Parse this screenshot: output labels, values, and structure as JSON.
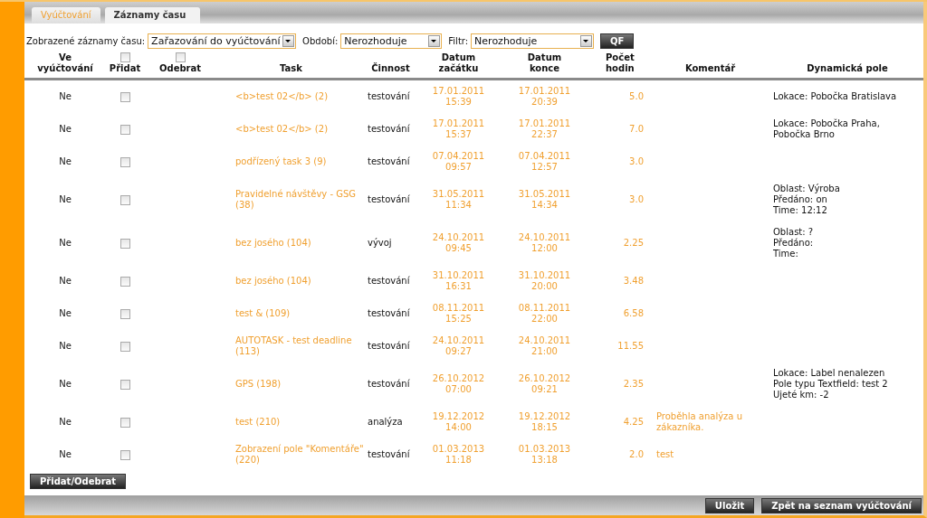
{
  "tabs": [
    {
      "label": "Vyúčtování",
      "selected": false
    },
    {
      "label": "Záznamy času",
      "selected": true
    }
  ],
  "filters": [
    {
      "label": "Zobrazené záznamy času:",
      "value": "Zařazování do vyúčtování"
    },
    {
      "label": "Období:",
      "value": "Nerozhoduje"
    },
    {
      "label": "Filtr:",
      "value": "Nerozhoduje"
    }
  ],
  "filter_button": "QF",
  "table": {
    "columns": [
      {
        "label": "Ve vyúčtování",
        "kind": "text"
      },
      {
        "label": "Přidat",
        "kind": "checkbox",
        "checked": false
      },
      {
        "label": "Odebrat",
        "kind": "checkbox",
        "checked": false
      },
      {
        "label": "Task",
        "kind": "text"
      },
      {
        "label": "Činnost",
        "kind": "text"
      },
      {
        "label": "Datum začátku",
        "kind": "text"
      },
      {
        "label": "Datum konce",
        "kind": "text"
      },
      {
        "label": "Počet hodin",
        "kind": "text"
      },
      {
        "label": "Komentář",
        "kind": "text"
      },
      {
        "label": "Dynamická pole",
        "kind": "text"
      }
    ],
    "rows": [
      {
        "in_billing": "Ne",
        "add_checked": false,
        "task": "<b>test 02</b> (2)",
        "activity": "testování",
        "start": [
          "17.01.2011",
          "15:39"
        ],
        "end": [
          "17.01.2011",
          "20:39"
        ],
        "hours": "5.0",
        "dynamic_fields": [
          "Lokace: Pobočka Bratislava"
        ]
      },
      {
        "in_billing": "Ne",
        "add_checked": false,
        "task": "<b>test 02</b> (2)",
        "activity": "testování",
        "start": [
          "17.01.2011",
          "15:37"
        ],
        "end": [
          "17.01.2011",
          "22:37"
        ],
        "hours": "7.0",
        "dynamic_fields": [
          "Lokace: Pobočka Praha,",
          "Pobočka Brno"
        ]
      },
      {
        "in_billing": "Ne",
        "add_checked": false,
        "task": "podřízený task 3 (9)",
        "activity": "testování",
        "start": [
          "07.04.2011",
          "09:57"
        ],
        "end": [
          "07.04.2011",
          "12:57"
        ],
        "hours": "3.0"
      },
      {
        "in_billing": "Ne",
        "add_checked": false,
        "task": "Pravidelné návštěvy - GSG (38)",
        "activity": "testování",
        "start": [
          "31.05.2011",
          "11:34"
        ],
        "end": [
          "31.05.2011",
          "14:34"
        ],
        "hours": "3.0",
        "dynamic_fields": [
          "Oblast: Výroba",
          "Předáno: on",
          "Time: 12:12"
        ]
      },
      {
        "in_billing": "Ne",
        "add_checked": false,
        "task": "bez josého (104)",
        "activity": "vývoj",
        "start": [
          "24.10.2011",
          "09:45"
        ],
        "end": [
          "24.10.2011",
          "12:00"
        ],
        "hours": "2.25",
        "dynamic_fields": [
          "Oblast: ?",
          "Předáno:",
          "Time:"
        ]
      },
      {
        "in_billing": "Ne",
        "add_checked": false,
        "task": "bez josého (104)",
        "activity": "testování",
        "start": [
          "31.10.2011",
          "16:31"
        ],
        "end": [
          "31.10.2011",
          "20:00"
        ],
        "hours": "3.48"
      },
      {
        "in_billing": "Ne",
        "add_checked": false,
        "task": "test & (109)",
        "activity": "testování",
        "start": [
          "08.11.2011",
          "15:25"
        ],
        "end": [
          "08.11.2011",
          "22:00"
        ],
        "hours": "6.58"
      },
      {
        "in_billing": "Ne",
        "add_checked": false,
        "task": "AUTOTASK - test deadline (113)",
        "activity": "testování",
        "start": [
          "24.10.2011",
          "09:27"
        ],
        "end": [
          "24.10.2011",
          "21:00"
        ],
        "hours": "11.55"
      },
      {
        "in_billing": "Ne",
        "add_checked": false,
        "task": "GPS (198)",
        "activity": "testování",
        "start": [
          "26.10.2012",
          "07:00"
        ],
        "end": [
          "26.10.2012",
          "09:21"
        ],
        "hours": "2.35",
        "dynamic_fields": [
          "Lokace: Label nenalezen",
          "Pole typu Textfield: test 2",
          "Ujeté km: -2"
        ]
      },
      {
        "in_billing": "Ne",
        "add_checked": false,
        "task": "test (210)",
        "activity": "analýza",
        "start": [
          "19.12.2012",
          "14:00"
        ],
        "end": [
          "19.12.2012",
          "18:15"
        ],
        "hours": "4.25",
        "comment": "Proběhla analýza u zákazníka."
      },
      {
        "in_billing": "Ne",
        "add_checked": false,
        "task": "Zobrazení pole \"Komentáře\" (220)",
        "activity": "testování",
        "start": [
          "01.03.2013",
          "11:18"
        ],
        "end": [
          "01.03.2013",
          "13:18"
        ],
        "hours": "2.0",
        "comment": "test"
      }
    ]
  },
  "table_button": "Přidat/Odebrat",
  "footer_buttons": [
    "Uložit",
    "Zpět na seznam vyúčtování"
  ]
}
